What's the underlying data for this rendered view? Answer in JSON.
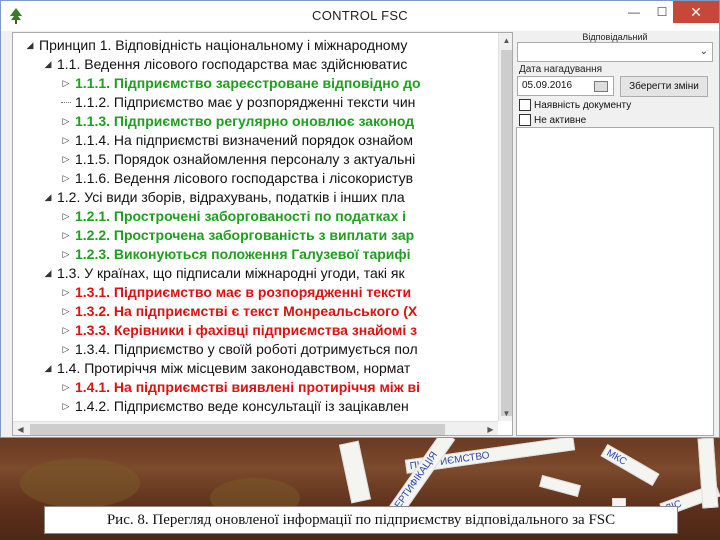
{
  "window": {
    "title": "CONTROL FSC",
    "controls": {
      "minimize": "—",
      "maximize": "☐",
      "close": "✕"
    }
  },
  "tree": {
    "rows": [
      {
        "text": "Принцип 1. Відповідність національному і міжнародному",
        "style": "normal",
        "level": 0,
        "expander": "◢"
      },
      {
        "text": "1.1. Ведення лісового господарства має здійснюватис",
        "style": "normal",
        "level": 1,
        "expander": "◢"
      },
      {
        "text": "1.1.1. Підприємство зареєстроване відповідно до",
        "style": "green",
        "level": 2,
        "expander": "▷"
      },
      {
        "text": "1.1.2. Підприємство має у розпорядженні тексти чин",
        "style": "normal",
        "level": 2,
        "expander": ""
      },
      {
        "text": "1.1.3. Підприємство регулярно оновлює законод",
        "style": "green",
        "level": 2,
        "expander": "▷"
      },
      {
        "text": "1.1.4. На підприємстві визначений порядок ознайом",
        "style": "normal",
        "level": 2,
        "expander": "▷"
      },
      {
        "text": "1.1.5. Порядок ознайомлення персоналу з актуальні",
        "style": "normal",
        "level": 2,
        "expander": "▷"
      },
      {
        "text": "1.1.6. Ведення лісового господарства і лісокористув",
        "style": "normal",
        "level": 2,
        "expander": "▷"
      },
      {
        "text": "1.2. Усі види зборів, відрахувань, податків і інших пла",
        "style": "normal",
        "level": 1,
        "expander": "◢"
      },
      {
        "text": "1.2.1. Прострочені заборгованості по податках і",
        "style": "green",
        "level": 2,
        "expander": "▷"
      },
      {
        "text": "1.2.2. Прострочена заборгованість з виплати зар",
        "style": "green",
        "level": 2,
        "expander": "▷"
      },
      {
        "text": "1.2.3. Виконуються положення Галузевої тарифі",
        "style": "green",
        "level": 2,
        "expander": "▷"
      },
      {
        "text": "1.3. У країнах, що підписали міжнародні угоди, такі як",
        "style": "normal",
        "level": 1,
        "expander": "◢"
      },
      {
        "text": "1.3.1. Підприємство має в розпорядженні тексти",
        "style": "red",
        "level": 2,
        "expander": "▷"
      },
      {
        "text": "1.3.2. На підприємстві є текст Монреальського (Х",
        "style": "red",
        "level": 2,
        "expander": "▷"
      },
      {
        "text": "1.3.3. Керівники і фахівці підприємства знайомі з",
        "style": "red",
        "level": 2,
        "expander": "▷"
      },
      {
        "text": "1.3.4. Підприємство у своїй роботі дотримується пол",
        "style": "normal",
        "level": 2,
        "expander": "▷"
      },
      {
        "text": "1.4. Протиріччя між місцевим законодавством, нормат",
        "style": "normal",
        "level": 1,
        "expander": "◢"
      },
      {
        "text": "1.4.1. На підприємстві виявлені протиріччя між ві",
        "style": "red",
        "level": 2,
        "expander": "▷"
      },
      {
        "text": "1.4.2. Підприємство веде консультації із зацікавлен",
        "style": "normal",
        "level": 2,
        "expander": "▷"
      }
    ]
  },
  "scroll": {
    "up": "▲",
    "down": "▼",
    "left": "◀",
    "right": "▶"
  },
  "side": {
    "responsible_label": "Відповідальний",
    "responsible_value": "",
    "responsible_caret": "⌄",
    "reminder_label": "Дата нагадування",
    "reminder_date": "05.09.2016",
    "save_button": "Зберегти зміни",
    "doc_present_label": "Наявність документу",
    "inactive_label": "Не активне"
  },
  "caption": "Рис. 8.  Перегляд оновленої інформації по підприємству відповідального за FSC",
  "photo_strips": [
    "ПІДПРИЄМСТВО",
    "МКС",
    "СЕРТИФІКАЦІЯ",
    "ЛІС"
  ],
  "colors": {
    "green_item": "#1f9f1f",
    "red_item": "#e01010",
    "close_button": "#c7483a",
    "window_border": "#7a9cc4"
  }
}
